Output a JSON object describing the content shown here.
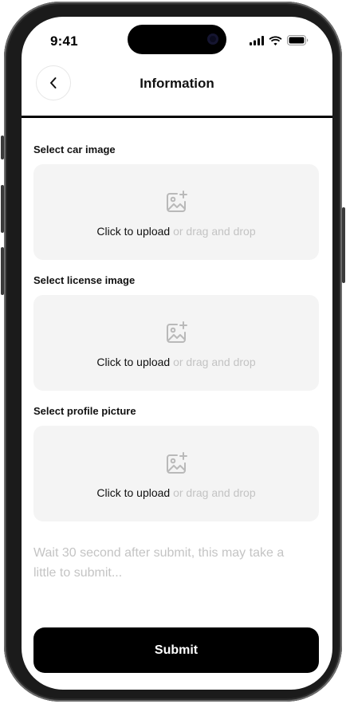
{
  "status_bar": {
    "time": "9:41"
  },
  "header": {
    "title": "Information",
    "back_icon": "chevron-left-icon"
  },
  "sections": [
    {
      "label": "Select car image",
      "action_text": "Click to upload",
      "hint_text": "or drag and drop",
      "icon": "image-add-icon"
    },
    {
      "label": "Select license image",
      "action_text": "Click to upload",
      "hint_text": "or drag and drop",
      "icon": "image-add-icon"
    },
    {
      "label": "Select profile picture",
      "action_text": "Click to upload",
      "hint_text": "or drag and drop",
      "icon": "image-add-icon"
    }
  ],
  "note": "Wait 30 second after submit, this may take a little to submit...",
  "submit_label": "Submit",
  "colors": {
    "accent": "#000000",
    "upload_bg": "#f4f4f4",
    "muted_text": "#c4c4c4"
  }
}
